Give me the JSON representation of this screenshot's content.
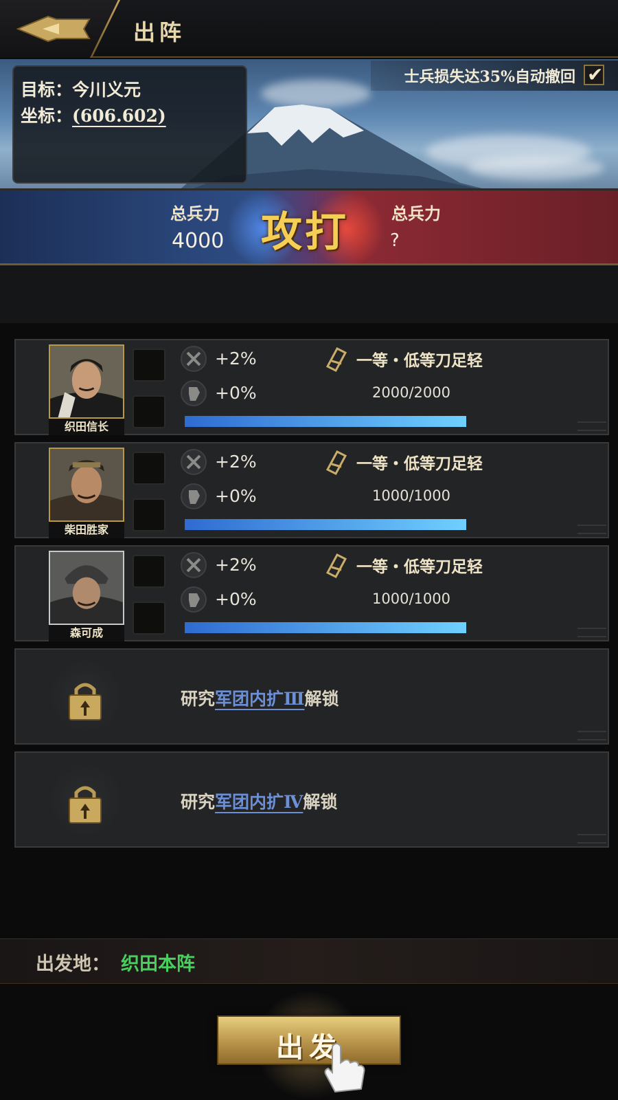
{
  "header": {
    "title": "出阵"
  },
  "target": {
    "target_label": "目标：",
    "target_name": "今川义元",
    "coord_label": "坐标：",
    "coord_value": "(606.602)"
  },
  "retreat": {
    "label": "士兵损失达35%自动撤回",
    "checked": true
  },
  "battle": {
    "left_label": "总兵力",
    "left_value": "4000",
    "action": "攻打",
    "right_label": "总兵力",
    "right_value": "?"
  },
  "heroes": [
    {
      "name": "织田信长",
      "attack_bonus": "+2%",
      "defense_bonus": "+0%",
      "troop_type": "一等・低等刀足轻",
      "troop_count": "2000/2000",
      "troop_fill": 1.0
    },
    {
      "name": "柴田胜家",
      "attack_bonus": "+2%",
      "defense_bonus": "+0%",
      "troop_type": "一等・低等刀足轻",
      "troop_count": "1000/1000",
      "troop_fill": 1.0
    },
    {
      "name": "森可成",
      "attack_bonus": "+2%",
      "defense_bonus": "+0%",
      "troop_type": "一等・低等刀足轻",
      "troop_count": "1000/1000",
      "troop_fill": 1.0
    }
  ],
  "locked_slots": [
    {
      "prefix": "研究",
      "link": "军团内扩Ⅲ",
      "suffix": "解锁"
    },
    {
      "prefix": "研究",
      "link": "军团内扩Ⅳ",
      "suffix": "解锁"
    }
  ],
  "departure": {
    "label": "出发地：",
    "value": "织田本阵"
  },
  "go_button": {
    "label": "出发"
  },
  "colors": {
    "accent_gold": "#b8934a",
    "troop_bar": "#4a90e2",
    "departure_green": "#47d05c",
    "link_blue": "#6d8fd6"
  },
  "icons": {
    "back": "back-arrow-icon",
    "attack_stat": "crossed-swords-icon",
    "defense_stat": "shield-icon",
    "troop": "troop-icon",
    "lock": "lock-icon",
    "hand": "tap-hand-icon"
  }
}
